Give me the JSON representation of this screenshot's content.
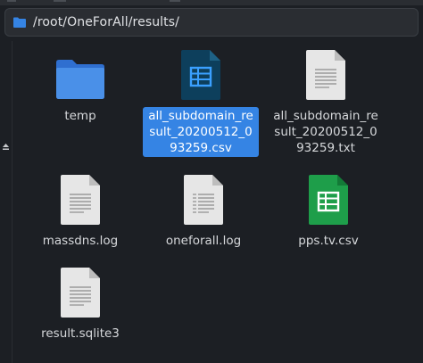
{
  "pathbar": {
    "path": "/root/OneForAll/results/",
    "icon": "folder-icon"
  },
  "accent_color": "#3584e4",
  "files": [
    {
      "name": "temp",
      "type": "folder",
      "icon": "folder-icon",
      "selected": false
    },
    {
      "name": "all_subdomain_result_20200512_093259.csv",
      "type": "spreadsheet",
      "icon": "spreadsheet-dark-icon",
      "selected": true
    },
    {
      "name": "all_subdomain_result_20200512_093259.txt",
      "type": "text",
      "icon": "text-file-icon",
      "selected": false
    },
    {
      "name": "massdns.log",
      "type": "text",
      "icon": "text-file-icon",
      "selected": false
    },
    {
      "name": "oneforall.log",
      "type": "text",
      "icon": "log-file-icon",
      "selected": false
    },
    {
      "name": "pps.tv.csv",
      "type": "spreadsheet",
      "icon": "spreadsheet-green-icon",
      "selected": false
    },
    {
      "name": "result.sqlite3",
      "type": "text",
      "icon": "text-file-icon",
      "selected": false
    }
  ]
}
